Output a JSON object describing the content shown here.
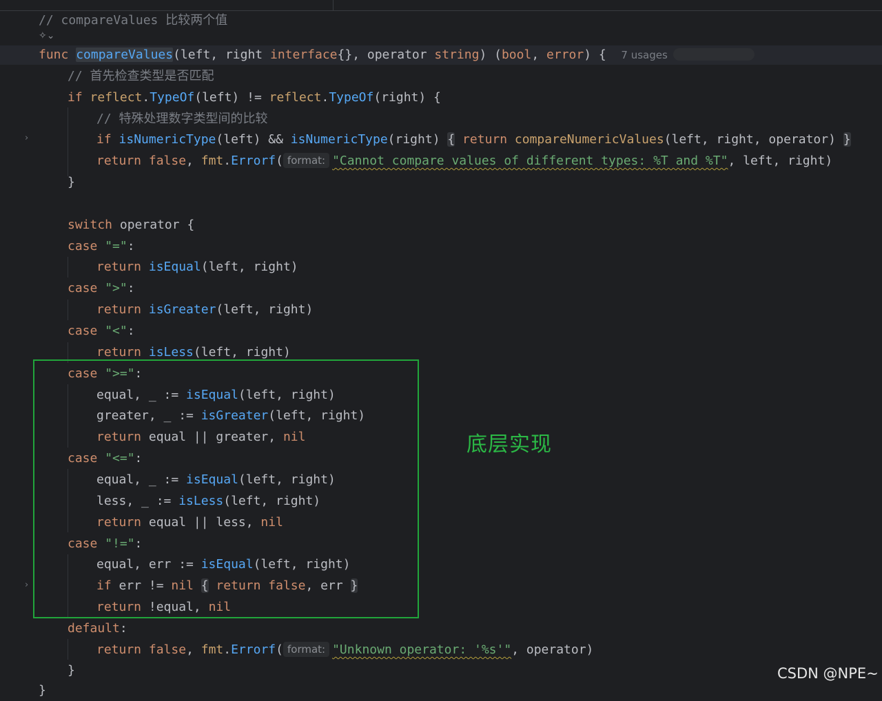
{
  "code": {
    "l01_comment": "// compareValues 比较两个值",
    "l03_func": "func",
    "l03_name": "compareValues",
    "l03_params": "(left, right ",
    "l03_iface": "interface",
    "l03_mid": "{}, operator ",
    "l03_string": "string",
    "l03_ret1": ") (",
    "l03_bool": "bool",
    "l03_comma": ", ",
    "l03_error": "error",
    "l03_end": ") {",
    "l03_usages": "7 usages",
    "l04_comment": "// 首先检查类型是否匹配",
    "l05_if": "if ",
    "l05_reflect1": "reflect",
    "l05_dot1": ".",
    "l05_typeof1": "TypeOf",
    "l05_mid": "(left) != ",
    "l05_reflect2": "reflect",
    "l05_dot2": ".",
    "l05_typeof2": "TypeOf",
    "l05_end": "(right) {",
    "l06_comment": "// 特殊处理数字类型间的比较",
    "l07_if": "if ",
    "l07_fn1": "isNumericType",
    "l07_mid": "(left) && ",
    "l07_fn2": "isNumericType",
    "l07_mid2": "(right) ",
    "l07_brace_open": "{",
    "l07_return": " return ",
    "l07_fn3": "compareNumericValues",
    "l07_args": "(left, right, operator) ",
    "l07_brace_close": "}",
    "l08_return": "return ",
    "l08_false": "false",
    "l08_comma": ", ",
    "l08_pkg": "fmt",
    "l08_dot": ".",
    "l08_errorf": "Errorf",
    "l08_paren": "(",
    "l08_hint": "format:",
    "l08_str": "\"Cannot compare values of different types: %T and %T\"",
    "l08_end": ", left, right)",
    "l09": "}",
    "l11_switch": "switch",
    "l11_rest": " operator {",
    "case_kw": "case",
    "c1_str": " \"=\"",
    "colon": ":",
    "return_kw": "return",
    "c1_fn": "isEqual",
    "args_lr": "(left, right)",
    "c2_str": " \">\"",
    "c2_fn": "isGreater",
    "c3_str": " \"<\"",
    "c3_fn": "isLess",
    "c4_str": " \">=\"",
    "c4_l1_pre": "equal, _ := ",
    "c4_l2_pre": "greater, _ := ",
    "c4_l3_mid": " equal || greater, ",
    "nil_kw": "nil",
    "c5_str": " \"<=\"",
    "c5_l2_pre": "less, _ := ",
    "c5_l3_mid": " equal || less, ",
    "c6_str": " \"!=\"",
    "c6_l1_pre": "equal, err := ",
    "c6_if": "if",
    "c6_err": " err != ",
    "c6_sp": " ",
    "c6_open": "{",
    "c6_ret": " return ",
    "c6_false": "false",
    "c6_comma_err": ", err ",
    "c6_close": "}",
    "c6_l3_mid": " !equal, ",
    "default_kw": "default",
    "d_hint": "format:",
    "d_str": "\"Unknown operator: '%s'\"",
    "d_end": ", operator)",
    "close_brace": "}"
  },
  "annotation": "底层实现",
  "watermark": "CSDN @NPE~"
}
